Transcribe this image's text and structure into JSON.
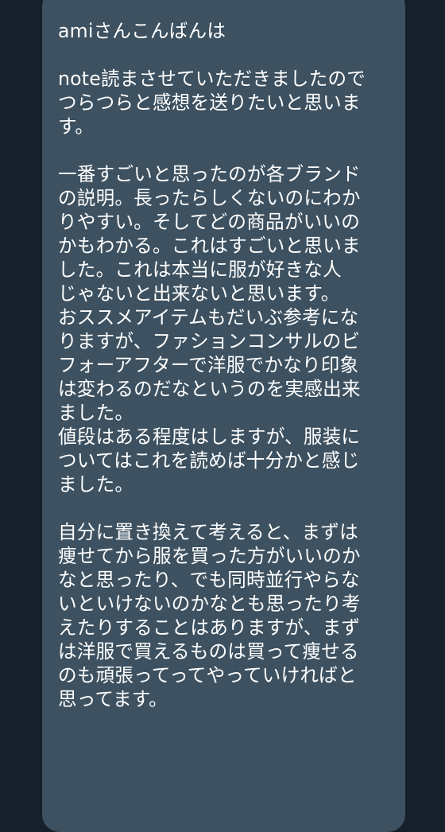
{
  "message": {
    "lines": [
      "amiさんこんばんは",
      "",
      "note読まさせていただきましたので",
      "つらつらと感想を送りたいと思いま",
      "す。",
      "",
      "一番すごいと思ったのが各ブランド",
      "の説明。長ったらしくないのにわか",
      "りやすい。そしてどの商品がいいの",
      "かもわかる。これはすごいと思いま",
      "した。これは本当に服が好きな人",
      "じゃないと出来ないと思います。",
      "おススメアイテムもだいぶ参考にな",
      "りますが、ファションコンサルのビ",
      "フォーアフターで洋服でかなり印象",
      "は変わるのだなというのを実感出来",
      "ました。",
      "値段はある程度はしますが、服装に",
      "ついてはこれを読めば十分かと感じ",
      "ました。",
      "",
      "自分に置き換えて考えると、まずは",
      "痩せてから服を買った方がいいのか",
      "なと思ったり、でも同時並行やらな",
      "いといけないのかなとも思ったり考",
      "えたりすることはありますが、まず",
      "は洋服で買えるものは買って痩せる",
      "のも頑張ってってやっていければと",
      "思ってます。"
    ]
  }
}
